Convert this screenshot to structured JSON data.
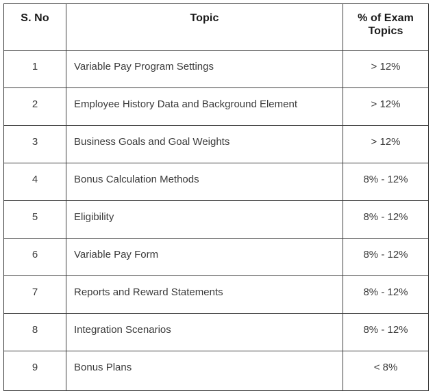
{
  "table": {
    "columns": [
      {
        "key": "sno",
        "label": "S. No"
      },
      {
        "key": "topic",
        "label": "Topic"
      },
      {
        "key": "pct",
        "label": "% of Exam Topics"
      }
    ],
    "header": {
      "sno": "S. No",
      "topic": "Topic",
      "pct_line1": "% of Exam",
      "pct_line2": "Topics"
    },
    "rows": [
      {
        "sno": "1",
        "topic": "Variable Pay Program Settings",
        "pct": "> 12%"
      },
      {
        "sno": "2",
        "topic": "Employee History Data and Background Element",
        "pct": "> 12%"
      },
      {
        "sno": "3",
        "topic": "Business Goals and Goal Weights",
        "pct": "> 12%"
      },
      {
        "sno": "4",
        "topic": "Bonus Calculation Methods",
        "pct": "8% - 12%"
      },
      {
        "sno": "5",
        "topic": "Eligibility",
        "pct": "8% - 12%"
      },
      {
        "sno": "6",
        "topic": "Variable Pay Form",
        "pct": "8% - 12%"
      },
      {
        "sno": "7",
        "topic": "Reports and Reward Statements",
        "pct": "8% - 12%"
      },
      {
        "sno": "8",
        "topic": "Integration Scenarios",
        "pct": "8% - 12%"
      },
      {
        "sno": "9",
        "topic": "Bonus Plans",
        "pct": "< 8%"
      }
    ]
  },
  "style": {
    "border_color": "#3b3b3b",
    "header_text_color": "#1a1a1a",
    "body_text_color": "#3a3a3a",
    "background_color": "#ffffff"
  }
}
